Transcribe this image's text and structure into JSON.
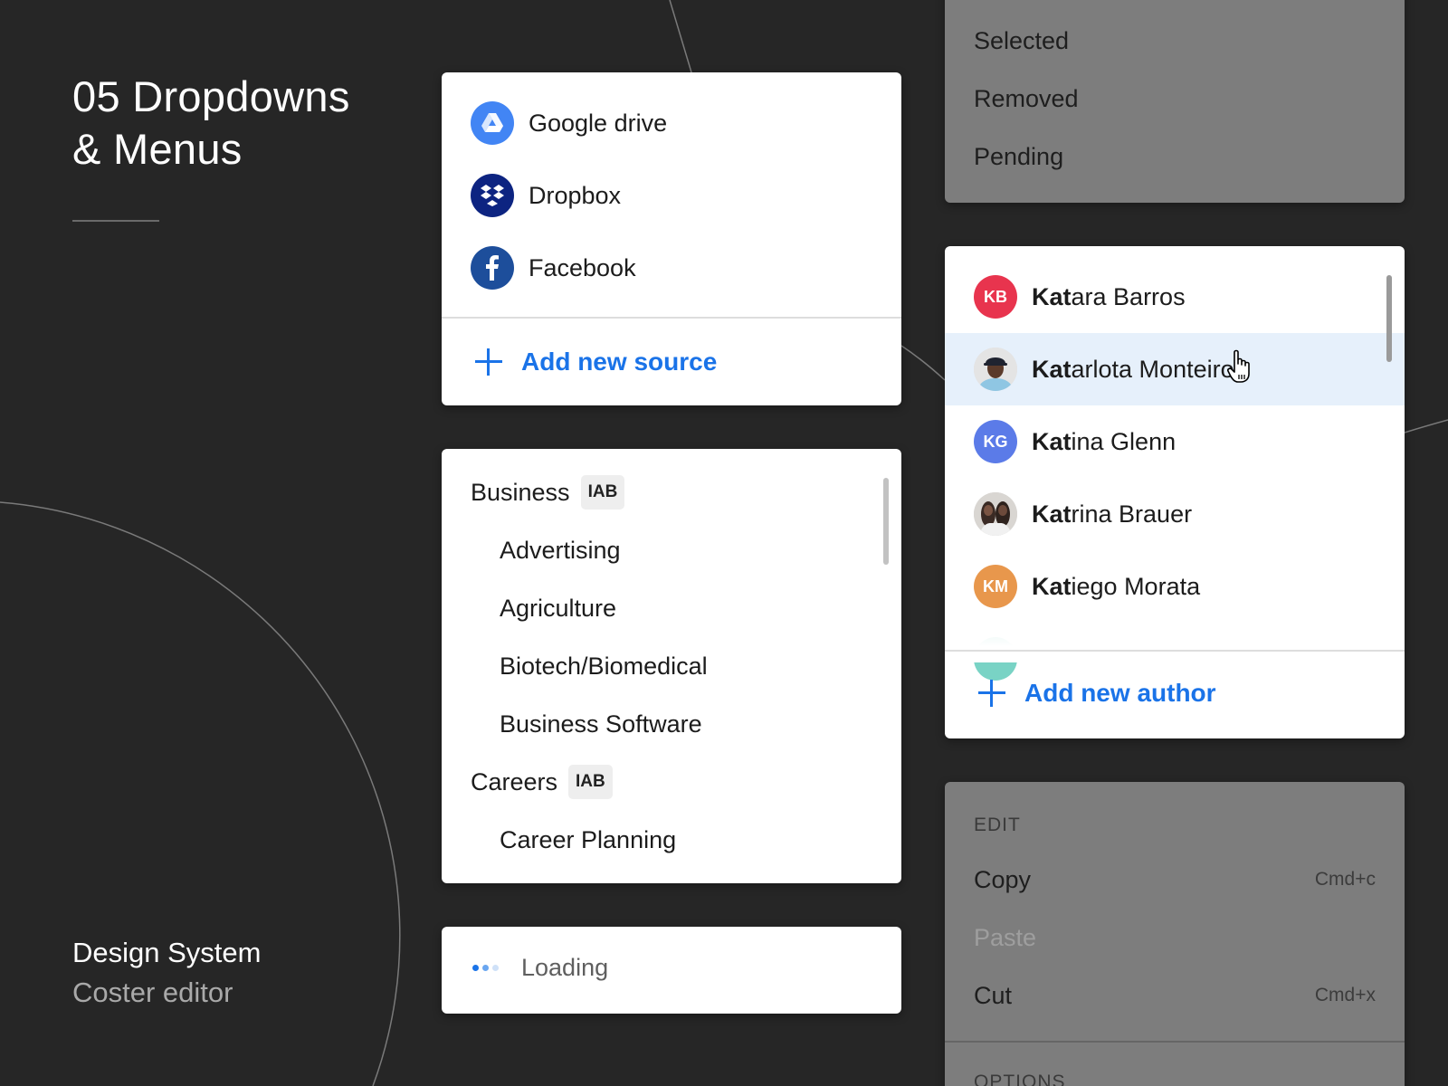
{
  "intro": {
    "title_line1": "05 Dropdowns",
    "title_line2": "& Menus",
    "footer_title": "Design System",
    "footer_subtitle": "Coster editor"
  },
  "sources": {
    "items": [
      {
        "label": "Google drive",
        "icon": "google-drive-icon",
        "color": "#4285f4"
      },
      {
        "label": "Dropbox",
        "icon": "dropbox-icon",
        "color": "#0d2481"
      },
      {
        "label": "Facebook",
        "icon": "facebook-icon",
        "color": "#1d4e9b"
      }
    ],
    "add_label": "Add new source"
  },
  "categories": {
    "items": [
      {
        "label": "Business",
        "badge": "IAB",
        "level": 0
      },
      {
        "label": "Advertising",
        "level": 1
      },
      {
        "label": "Agriculture",
        "level": 1
      },
      {
        "label": "Biotech/Biomedical",
        "level": 1
      },
      {
        "label": "Business Software",
        "level": 1
      },
      {
        "label": "Careers",
        "badge": "IAB",
        "level": 0
      },
      {
        "label": "Career Planning",
        "level": 1
      }
    ]
  },
  "loading": {
    "label": "Loading",
    "dot_colors": [
      "#1a73e8",
      "#6aa6f0",
      "#cfe1f8"
    ]
  },
  "status": {
    "items": [
      "Selected",
      "Removed",
      "Pending"
    ]
  },
  "authors": {
    "query": "Kat",
    "items": [
      {
        "match": "Kat",
        "rest": "ara Barros",
        "initials": "KB",
        "color": "#e8344e"
      },
      {
        "match": "Kat",
        "rest": "arlota Monteiro",
        "initials": "",
        "color": "#d9d9d9",
        "hovered": true
      },
      {
        "match": "Kat",
        "rest": "ina Glenn",
        "initials": "KG",
        "color": "#5b7be8"
      },
      {
        "match": "Kat",
        "rest": "rina Brauer",
        "initials": "",
        "color": "#cccccc"
      },
      {
        "match": "Kat",
        "rest": "iego Morata",
        "initials": "KM",
        "color": "#e8974c"
      }
    ],
    "partial_avatar_color": "#79d3c5",
    "add_label": "Add new author"
  },
  "edit_menu": {
    "heading": "EDIT",
    "items": [
      {
        "label": "Copy",
        "shortcut": "Cmd+c",
        "disabled": false
      },
      {
        "label": "Paste",
        "shortcut": "",
        "disabled": true
      },
      {
        "label": "Cut",
        "shortcut": "Cmd+x",
        "disabled": false
      }
    ],
    "next_heading": "OPTIONS"
  }
}
